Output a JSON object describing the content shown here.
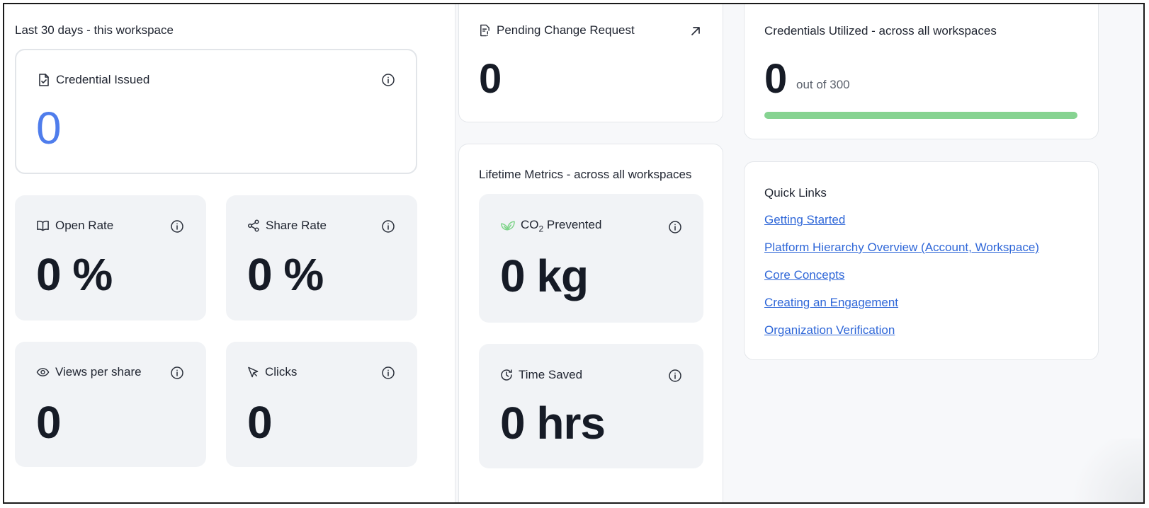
{
  "workspace_section": {
    "label": "Last 30 days - this workspace",
    "credential_issued": {
      "title": "Credential Issued",
      "value": "0"
    },
    "open_rate": {
      "title": "Open Rate",
      "value": "0 %"
    },
    "share_rate": {
      "title": "Share Rate",
      "value": "0 %"
    },
    "views_per_share": {
      "title": "Views per share",
      "value": "0"
    },
    "clicks": {
      "title": "Clicks",
      "value": "0"
    }
  },
  "pending_change_request": {
    "title": "Pending Change Request",
    "value": "0"
  },
  "lifetime_metrics": {
    "label": "Lifetime Metrics - across all workspaces",
    "co2_prevented": {
      "title_prefix": "CO",
      "title_sub": "2",
      "title_suffix": " Prevented",
      "value": "0 kg"
    },
    "time_saved": {
      "title": "Time Saved",
      "value": "0 hrs"
    }
  },
  "credentials_utilized": {
    "title": "Credentials Utilized - across all workspaces",
    "value": "0",
    "out_of": "out of 300",
    "progress_fraction": 0
  },
  "quick_links": {
    "title": "Quick Links",
    "items": [
      {
        "label": "Getting Started"
      },
      {
        "label": "Platform Hierarchy Overview (Account, Workspace)"
      },
      {
        "label": "Core Concepts"
      },
      {
        "label": "Creating an Engagement"
      },
      {
        "label": "Organization Verification"
      }
    ]
  },
  "colors": {
    "accent_blue": "#4f7dec",
    "link_blue": "#2f67d8",
    "progress_green": "#86d391",
    "leaf_green": "#7fd48a"
  },
  "icons": [
    "document-check-icon",
    "info-icon",
    "book-open-icon",
    "share-icon",
    "eye-icon",
    "cursor-click-icon",
    "document-edit-icon",
    "arrow-up-right-icon",
    "leaf-icon",
    "clock-icon"
  ]
}
